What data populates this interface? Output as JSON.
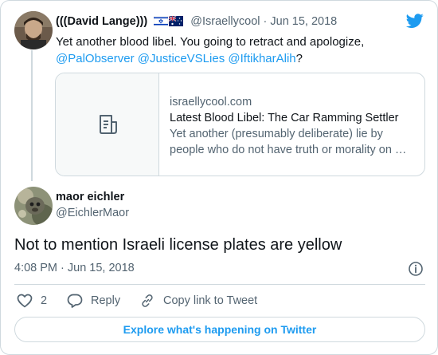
{
  "colors": {
    "accent": "#1d9bf0",
    "secondary_text": "#536471",
    "border": "#cfd9de"
  },
  "parent_tweet": {
    "display_name": "(((David Lange)))",
    "flags": [
      "israel-flag-icon",
      "australia-flag-icon"
    ],
    "handle": "@Israellycool",
    "separator": " · ",
    "date": "Jun 15, 2018",
    "text_before": "Yet another blood libel. You going to retract and apologize,",
    "mentions": [
      "@PalObserver",
      "@JusticeVSLies",
      "@IftikharAlih"
    ],
    "text_after": "?",
    "link_card": {
      "domain": "israellycool.com",
      "title": "Latest Blood Libel: The Car Ramming Settler",
      "description_line1": "Yet another (presumably deliberate) lie by",
      "description_line2": "people who do not have truth or morality on …"
    }
  },
  "main_tweet": {
    "display_name": "maor eichler",
    "handle": "@EichlerMaor",
    "text": "Not to mention Israeli license plates are yellow",
    "timestamp": "4:08 PM · Jun 15, 2018"
  },
  "actions": {
    "like_count": "2",
    "reply_label": "Reply",
    "copy_link_label": "Copy link to Tweet"
  },
  "explore_label": "Explore what's happening on Twitter",
  "icons": [
    "twitter-bird-icon",
    "article-icon",
    "info-icon",
    "heart-icon",
    "reply-icon",
    "link-icon"
  ]
}
